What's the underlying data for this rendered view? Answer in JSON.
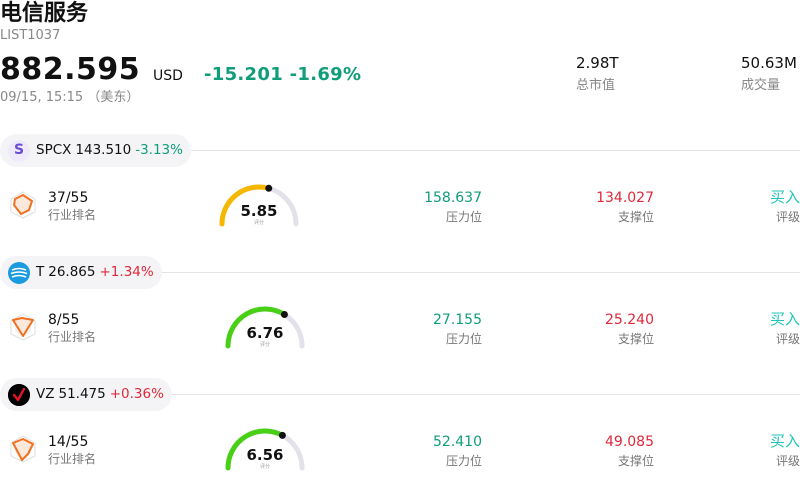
{
  "header": {
    "title": "电信服务",
    "code": "LIST1037",
    "price": "882.595",
    "currency": "USD",
    "change": "-15.201 -1.69%",
    "time": "09/15, 15:15 （美东）"
  },
  "stats": {
    "market_cap": {
      "value": "2.98T",
      "label": "总市值"
    },
    "volume": {
      "value": "50.63M",
      "label": "成交量"
    }
  },
  "colors": {
    "up": "#e0283a",
    "down": "#0f9d7a",
    "rating": "#20c5b7"
  },
  "stocks": [
    {
      "logo_text": "S",
      "symbol": "SPCX",
      "price": "143.510",
      "pct": "-3.13%",
      "rank": "37/55",
      "rank_label": "行业排名",
      "score": "5.85",
      "score_value": 5.85,
      "score_label": "评分",
      "resistance": "158.637",
      "resistance_label": "压力位",
      "support": "134.027",
      "support_label": "支撑位",
      "rating": "买入",
      "rating_label": "评级"
    },
    {
      "logo_text": "",
      "symbol": "T",
      "price": "26.865",
      "pct": "+1.34%",
      "rank": "8/55",
      "rank_label": "行业排名",
      "score": "6.76",
      "score_value": 6.76,
      "score_label": "评分",
      "resistance": "27.155",
      "resistance_label": "压力位",
      "support": "25.240",
      "support_label": "支撑位",
      "rating": "买入",
      "rating_label": "评级"
    },
    {
      "logo_text": "",
      "symbol": "VZ",
      "price": "51.475",
      "pct": "+0.36%",
      "rank": "14/55",
      "rank_label": "行业排名",
      "score": "6.56",
      "score_value": 6.56,
      "score_label": "评分",
      "resistance": "52.410",
      "resistance_label": "压力位",
      "support": "49.085",
      "support_label": "支撑位",
      "rating": "买入",
      "rating_label": "评级"
    }
  ]
}
